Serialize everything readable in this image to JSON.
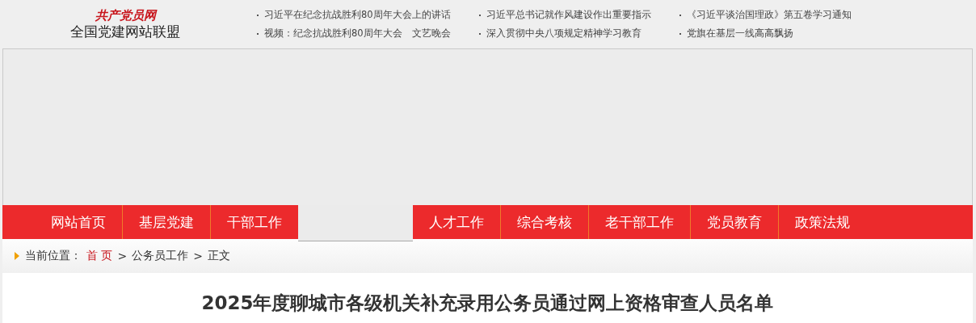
{
  "logo": {
    "brand": "共产党员网",
    "subtitle": "全国党建网站联盟"
  },
  "headlines": [
    {
      "text": "习近平在纪念抗战胜利80周年大会上的讲话"
    },
    {
      "text": "习近平总书记就作风建设作出重要指示"
    },
    {
      "text": "《习近平谈治国理政》第五卷学习通知"
    },
    {
      "text": "视频：纪念抗战胜利80周年大会　文艺晚会"
    },
    {
      "text": "深入贯彻中央八项规定精神学习教育"
    },
    {
      "text": "党旗在基层一线高高飘扬"
    }
  ],
  "nav_left": [
    "网站首页",
    "基层党建",
    "干部工作"
  ],
  "nav_right": [
    "人才工作",
    "综合考核",
    "老干部工作",
    "党员教育",
    "政策法规"
  ],
  "breadcrumb": {
    "label": "当前位置：",
    "separator": ">",
    "items": [
      {
        "text": "首 页",
        "kind": "link"
      },
      {
        "text": "公务员工作",
        "kind": "plain"
      },
      {
        "text": "正文",
        "kind": "plain"
      }
    ]
  },
  "article": {
    "title": "2025年度聊城市各级机关补充录用公务员通过网上资格审查人员名单"
  }
}
